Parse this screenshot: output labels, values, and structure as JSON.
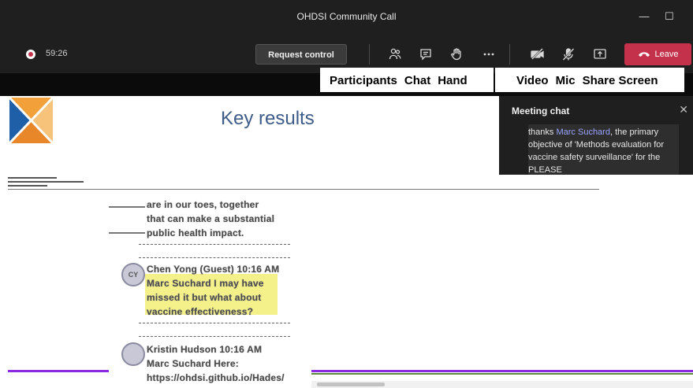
{
  "window": {
    "title": "OHDSI Community Call",
    "minimize_glyph": "—",
    "maximize_glyph": "☐",
    "close_glyph": "✕"
  },
  "controls": {
    "timer": "59:26",
    "request_control": "Request control",
    "leave": "Leave",
    "icons": [
      "participants-icon",
      "chat-icon",
      "raise-hand-icon",
      "more-options-icon",
      "video-off-icon",
      "mic-off-icon",
      "share-screen-icon",
      "phone-hangup-icon"
    ],
    "leave_color": "#c4314b"
  },
  "callouts": {
    "left": [
      "Participants",
      "Chat",
      "Hand"
    ],
    "right": [
      "Video",
      "Mic",
      "Share Screen"
    ]
  },
  "slide": {
    "title": "Key results",
    "title_color": "#3d5c8a",
    "snippet_lines": [
      "are in our toes, together",
      "that can make a substantial",
      "public health impact."
    ],
    "message1": {
      "avatar": "CY",
      "author": "Chen Yong (Guest)   10:16 AM",
      "lines": [
        "Marc Suchard I may have",
        "missed it but what about",
        "vaccine effectiveness?"
      ]
    },
    "message2": {
      "author": "Kristin Hudson   10:16 AM",
      "lines": [
        "Marc Suchard  Here:",
        "https://ohdsi.github.io/Hades/"
      ]
    }
  },
  "chat_panel": {
    "title": "Meeting chat",
    "close": "✕",
    "mention": "Marc Suchard",
    "lead": "thanks",
    "after_mention": ", the",
    "body": "primary objective of 'Methods evaluation for vaccine safety surveillance' for the PLEASE"
  }
}
